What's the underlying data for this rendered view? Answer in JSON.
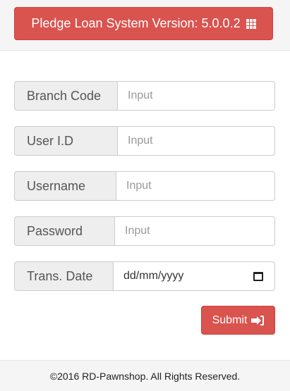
{
  "header": {
    "title": "Pledge Loan System Version: 5.0.0.2",
    "icon": "grid-icon"
  },
  "form": {
    "branch_code": {
      "label": "Branch Code",
      "placeholder": "Input",
      "value": ""
    },
    "user_id": {
      "label": "User I.D",
      "placeholder": "Input",
      "value": ""
    },
    "username": {
      "label": "Username",
      "placeholder": "Input",
      "value": ""
    },
    "password": {
      "label": "Password",
      "placeholder": "Input",
      "value": ""
    },
    "trans_date": {
      "label": "Trans. Date",
      "value": "dd/mm/yyyy",
      "icon": "calendar-icon"
    },
    "submit_label": "Submit",
    "submit_icon": "sign-in-icon"
  },
  "footer": {
    "copyright": "©2016 RD-Pawnshop. All Rights Reserved."
  },
  "colors": {
    "accent": "#d9534f",
    "addon_bg": "#eeeeee",
    "bar_bg": "#f5f5f5"
  }
}
